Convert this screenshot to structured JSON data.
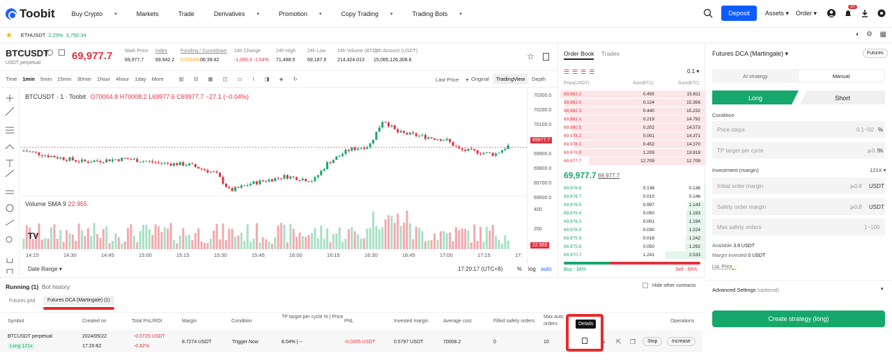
{
  "brand": "Toobit",
  "nav": [
    {
      "label": "Buy Crypto",
      "chev": true
    },
    {
      "label": "Markets"
    },
    {
      "label": "Trade"
    },
    {
      "label": "Derivatives",
      "chev": true
    },
    {
      "label": "Promotion",
      "chev": true
    },
    {
      "label": "Copy Trading",
      "chev": true
    },
    {
      "label": "Trading Bots",
      "chev": true
    }
  ],
  "topright": {
    "deposit": "Deposit",
    "assets": "Assets",
    "order": "Order",
    "badge": "20"
  },
  "fav": {
    "symbol": "ETHUSDT",
    "change": "2.29%",
    "price": "3,750.34"
  },
  "ticker": {
    "symbol": "BTCUSDT",
    "sub": "USDT perpetual",
    "price": "69,977.7",
    "stats": [
      {
        "label": "Mark Price",
        "value": "69,977.7"
      },
      {
        "label": "Index",
        "value": "69,942.2"
      },
      {
        "label": "Funding / Countdown",
        "value": "0.0153%",
        "value2": "06:39:42"
      },
      {
        "label": "24h Change",
        "value": "-1,095.3 -1.54%"
      },
      {
        "label": "24h High",
        "value": "71,498.5"
      },
      {
        "label": "24h Low",
        "value": "69,187.9"
      },
      {
        "label": "24h Volume (BTC)",
        "value": "214,424.013"
      },
      {
        "label": "24h Amount (USDT)",
        "value": "15,065,126,308.8"
      }
    ]
  },
  "tools": {
    "intervals": [
      "Time",
      "1min",
      "5min",
      "15min",
      "30min",
      "1hour",
      "4hour",
      "1day",
      "More"
    ],
    "lastprice": "Last Price",
    "views": [
      "Original",
      "TradingView",
      "Depth"
    ]
  },
  "chart": {
    "title": "BTCUSDT · 1 · Toobit",
    "o": "O70004.8",
    "h": "H70008.2",
    "l": "L69977.6",
    "c": "C69977.7",
    "chg": "−27.1 (−0.04%)",
    "price_tag": "69977.7",
    "volume_label": "Volume SMA 9",
    "volume_val": "22.955",
    "vol_tag": "22.955",
    "yticks": [
      "70300.0",
      "70200.0",
      "70100.0",
      "70000.0",
      "69900.0",
      "69800.0",
      "69700.0",
      "69600.0"
    ],
    "vticks": [
      "400",
      "200"
    ],
    "xticks": [
      "14:15",
      "14:30",
      "14:45",
      "15:00",
      "15:15",
      "15:30",
      "15:45",
      "16:00",
      "16:15",
      "16:30",
      "16:45",
      "17:00",
      "17:15",
      "17:"
    ],
    "daterange": "Date Range",
    "clock": "17:20:17 (UTC+8)",
    "pct": "%",
    "log": "log",
    "auto": "auto"
  },
  "orderbook": {
    "tabs": [
      "Order Book",
      "Trades"
    ],
    "step": "0.1",
    "cols": [
      "Price(USDT)",
      "Size(BTC)",
      "Sum(BTC)"
    ],
    "asks": [
      [
        "69,983.2",
        "0.455",
        "15.811"
      ],
      [
        "69,983.0",
        "0.124",
        "15.356"
      ],
      [
        "69,982.3",
        "0.440",
        "15.232"
      ],
      [
        "69,981.1",
        "0.219",
        "14.792"
      ],
      [
        "69,980.5",
        "0.202",
        "14.573"
      ],
      [
        "69,978.2",
        "0.001",
        "14.371"
      ],
      [
        "69,978.1",
        "0.452",
        "14.370"
      ],
      [
        "69,978.0",
        "1.209",
        "13.918"
      ],
      [
        "69,977.7",
        "12.709",
        "12.709"
      ]
    ],
    "mid": "69,977.7",
    "mid2": "69,977.7",
    "bids": [
      [
        "69,976.8",
        "0.136",
        "0.136"
      ],
      [
        "69,976.7",
        "0.010",
        "0.146"
      ],
      [
        "69,976.5",
        "0.997",
        "1.143"
      ],
      [
        "69,976.4",
        "0.050",
        "1.193"
      ],
      [
        "69,976.3",
        "0.001",
        "1.194"
      ],
      [
        "69,976.0",
        "0.030",
        "1.224"
      ],
      [
        "69,975.9",
        "0.018",
        "1.242"
      ],
      [
        "69,975.8",
        "0.050",
        "1.292"
      ],
      [
        "69,970.7",
        "1.241",
        "2.533"
      ]
    ],
    "buy": "Buy : 34%",
    "sell": "Sell : 66%"
  },
  "panel": {
    "title": "Futures DCA (Martingale)",
    "tag": "Futures",
    "modes": [
      "AI strategy",
      "Manual"
    ],
    "long": "Long",
    "short": "Short",
    "condition": "Condition",
    "price_steps": "Price steps",
    "price_steps_range": "0.1~50",
    "pct": "%",
    "tp": "TP target per cycle",
    "tp_range": "⩾0.1",
    "investment": "Investment (margin)",
    "leverage": "121X",
    "initial": "Initial order margin",
    "initial_min": "⩾0.8",
    "usdt": "USDT",
    "safety": "Safety order margin",
    "safety_min": "⩾0.8",
    "max_safety": "Max safety orders",
    "max_range": "1~100",
    "available": "Available",
    "avail_val": "3.8 USDT",
    "margin_inv": "Margin invested",
    "margin_val": "0 USDT",
    "liq": "Liq. Price",
    "liq_val": "--",
    "advanced": "Advanced Settings",
    "optional": "(optional)",
    "create": "Create strategy (long)"
  },
  "bottom": {
    "tabs": [
      "Running (1)",
      "Bot history"
    ],
    "subtabs": [
      "Futures grid",
      "Futures DCA (Martingale) (1)"
    ],
    "hide": "Hide other contracts",
    "cols": [
      "Symbol",
      "Created on",
      "Total PnL/ROI",
      "Margin",
      "Condition",
      "TP target per cycle % | Price",
      "PNL",
      "Invested margin",
      "Average cost",
      "Filled safety orders",
      "Max auto orders",
      "Operations"
    ],
    "row": {
      "symbol": "BTCUSDT perpetual",
      "side": "Long 121x",
      "date": "2024/05/22",
      "time": "17:20:62",
      "pnl": "-0.0725 USDT",
      "roi": "-0.82%",
      "margin": "8.7274 USDT",
      "condition": "Trigger Now",
      "tp": "8.04% | --",
      "pnl2": "-0.0305 USDT",
      "invested": "0.5797 USDT",
      "avg": "70008.2",
      "filled": "0",
      "max": "10",
      "stop": "Stop",
      "increase": "Increase"
    },
    "tooltip": "Details"
  }
}
